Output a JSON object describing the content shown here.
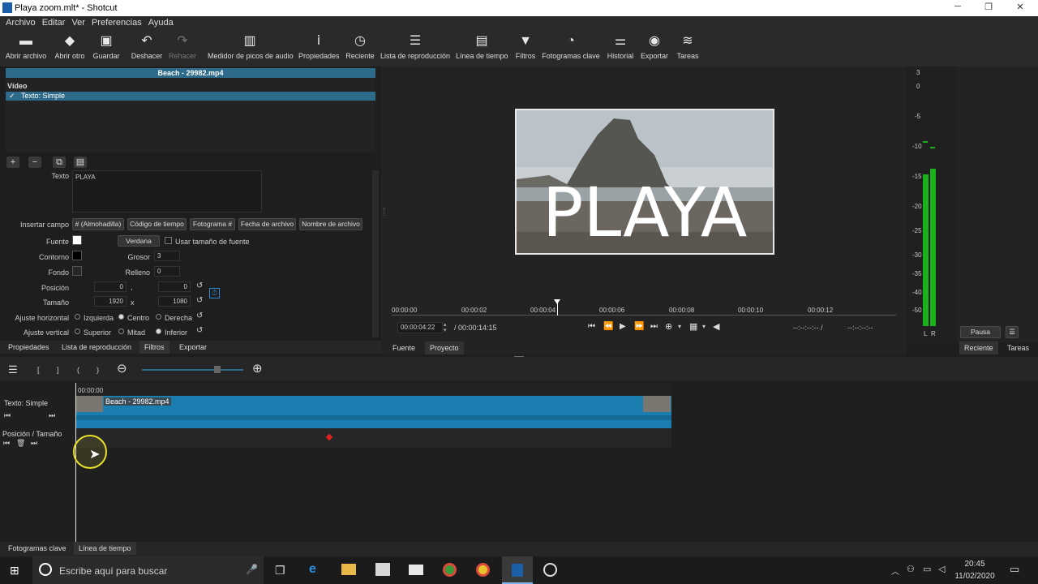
{
  "window": {
    "title": "Playa zoom.mlt* - Shotcut",
    "min": "─",
    "max": "❐",
    "close": "✕"
  },
  "menu": [
    "Archivo",
    "Editar",
    "Ver",
    "Preferencias",
    "Ayuda"
  ],
  "toolbar": [
    {
      "label": "Abrir archivo",
      "icon": "folder-icon",
      "glyph": "▬"
    },
    {
      "label": "Abrir otro",
      "icon": "open-other-icon",
      "glyph": "◆"
    },
    {
      "label": "Guardar",
      "icon": "save-icon",
      "glyph": "▣"
    },
    {
      "label": "Deshacer",
      "icon": "undo-icon",
      "glyph": "↶"
    },
    {
      "label": "Rehacer",
      "icon": "redo-icon",
      "glyph": "↷"
    },
    {
      "label": "Medidor de picos de audio",
      "icon": "audio-meter-icon",
      "glyph": "▥"
    },
    {
      "label": "Propiedades",
      "icon": "info-icon",
      "glyph": "ⅰ"
    },
    {
      "label": "Reciente",
      "icon": "clock-icon",
      "glyph": "◷"
    },
    {
      "label": "Lista de reproducción",
      "icon": "playlist-icon",
      "glyph": "☰"
    },
    {
      "label": "Línea de tiempo",
      "icon": "timeline-icon",
      "glyph": "▤"
    },
    {
      "label": "Filtros",
      "icon": "filter-icon",
      "glyph": "▼"
    },
    {
      "label": "Fotogramas clave",
      "icon": "stopwatch-icon",
      "glyph": "◔"
    },
    {
      "label": "Historial",
      "icon": "history-icon",
      "glyph": "⚌"
    },
    {
      "label": "Exportar",
      "icon": "export-icon",
      "glyph": "◉"
    },
    {
      "label": "Tareas",
      "icon": "jobs-icon",
      "glyph": "≋"
    }
  ],
  "filters": {
    "clip": "Beach - 29982.mp4",
    "section": "Vídeo",
    "item": "Texto: Simple",
    "check": "✓",
    "text_label": "Texto",
    "text_value": "PLAYA",
    "insert_label": "Insertar campo",
    "insert_buttons": [
      "# (Almohadilla)",
      "Código de tiempo",
      "Fotograma #",
      "Fecha de archivo",
      "Nombre de archivo"
    ],
    "font_label": "Fuente",
    "font_button": "Verdana",
    "use_font_size": "Usar tamaño de fuente",
    "outline_label": "Contorno",
    "thickness_label": "Grosor",
    "thickness": "3",
    "bg_label": "Fondo",
    "padding_label": "Relleno",
    "padding": "0",
    "pos_label": "Posición",
    "pos_x": "0",
    "pos_sep": ",",
    "pos_y": "0",
    "size_label": "Tamaño",
    "size_w": "1920",
    "size_x": "x",
    "size_h": "1080",
    "halign_label": "Ajuste horizontal",
    "halign": [
      "Izquierda",
      "Centro",
      "Derecha"
    ],
    "valign_label": "Ajuste vertical",
    "valign": [
      "Superior",
      "Mitad",
      "Inferior"
    ]
  },
  "left_tabs": [
    "Propiedades",
    "Lista de reproducción",
    "Filtros",
    "Exportar"
  ],
  "player": {
    "overlay_text": "PLAYA",
    "ticks": [
      "00:00:00",
      "00:00:02",
      "00:00:04",
      "00:00:06",
      "00:00:08",
      "00:00:10",
      "00:00:12"
    ],
    "current": "00:00:04:22",
    "total": "/ 00:00:14:15",
    "in_point": "--:--:--:-- /",
    "out_point": "--:--:--:--",
    "tabs": [
      "Fuente",
      "Proyecto"
    ]
  },
  "meter": {
    "scale": [
      "3",
      "0",
      "-5",
      "-10",
      "-15",
      "-20",
      "-25",
      "-30",
      "-35",
      "-40",
      "-50"
    ],
    "l": "L",
    "r": "R"
  },
  "right_panel": {
    "pause": "Pausa",
    "tabs": [
      "Reciente",
      "Tareas"
    ]
  },
  "timeline": {
    "toolbar": [
      "☰",
      "[",
      "]",
      "(",
      ")"
    ],
    "start": "00:00:00",
    "track1": "Texto: Simple",
    "clip": "Beach - 29982.mp4",
    "track2": "Posición / Tamaño"
  },
  "bottom_tabs": [
    "Fotogramas clave",
    "Línea de tiempo"
  ],
  "taskbar": {
    "search": "Escribe aquí para buscar",
    "time": "20:45",
    "date": "11/02/2020"
  },
  "colors": {
    "accent": "#2e6a8a",
    "clip": "#1a7fb0",
    "meter": "#19b21a"
  }
}
